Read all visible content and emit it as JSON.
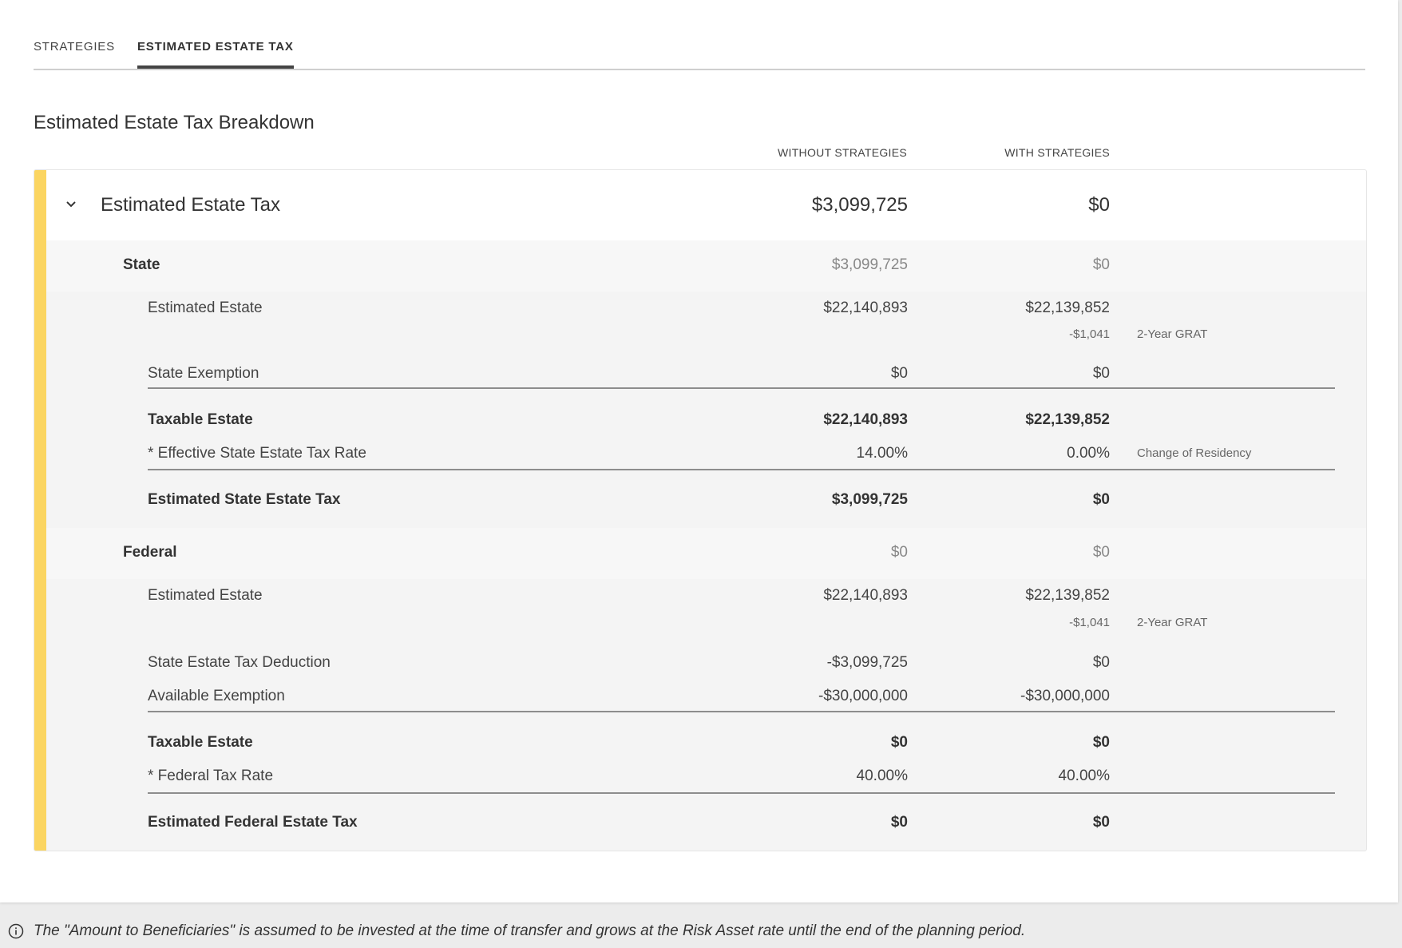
{
  "tabs": [
    "STRATEGIES",
    "ESTIMATED ESTATE TAX"
  ],
  "section_title": "Estimated Estate Tax Breakdown",
  "columns": {
    "without": "WITHOUT STRATEGIES",
    "with": "WITH STRATEGIES"
  },
  "summary": {
    "label": "Estimated Estate Tax",
    "without": "$3,099,725",
    "with": "$0"
  },
  "state": {
    "label": "State",
    "without": "$3,099,725",
    "with": "$0",
    "estimated_estate": {
      "label": "Estimated Estate",
      "without": "$22,140,893",
      "with": "$22,139,852",
      "delta": "-$1,041",
      "note": "2-Year GRAT"
    },
    "exemption": {
      "label": "State Exemption",
      "without": "$0",
      "with": "$0"
    },
    "taxable": {
      "label": "Taxable Estate",
      "without": "$22,140,893",
      "with": "$22,139,852"
    },
    "rate": {
      "label": "* Effective State Estate Tax Rate",
      "without": "14.00%",
      "with": "0.00%",
      "note": "Change of Residency"
    },
    "tax": {
      "label": "Estimated State Estate Tax",
      "without": "$3,099,725",
      "with": "$0"
    }
  },
  "federal": {
    "label": "Federal",
    "without": "$0",
    "with": "$0",
    "estimated_estate": {
      "label": "Estimated Estate",
      "without": "$22,140,893",
      "with": "$22,139,852",
      "delta": "-$1,041",
      "note": "2-Year GRAT"
    },
    "deduction": {
      "label": "State Estate Tax Deduction",
      "without": "-$3,099,725",
      "with": "$0"
    },
    "exemption": {
      "label": "Available Exemption",
      "without": "-$30,000,000",
      "with": "-$30,000,000"
    },
    "taxable": {
      "label": "Taxable Estate",
      "without": "$0",
      "with": "$0"
    },
    "rate": {
      "label": "* Federal Tax Rate",
      "without": "40.00%",
      "with": "40.00%"
    },
    "tax": {
      "label": "Estimated Federal Estate Tax",
      "without": "$0",
      "with": "$0"
    }
  },
  "footer_note": "The \"Amount to Beneficiaries\" is assumed to be invested at the time of transfer and grows at the Risk Asset rate until the end of the planning period.",
  "colors": {
    "accent": "#fbd561",
    "panel_bg": "#f4f4f4"
  },
  "icons": {
    "chevron": "chevron-down-icon",
    "info": "info-icon"
  }
}
